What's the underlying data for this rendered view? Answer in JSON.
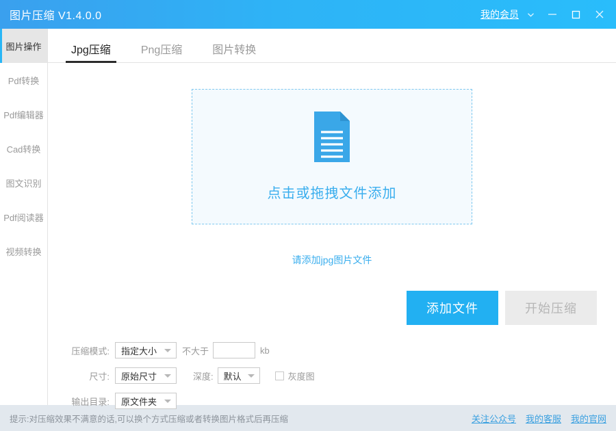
{
  "titlebar": {
    "app_title": "图片压缩 V1.4.0.0",
    "member_link": "我的会员",
    "icons": {
      "chevron": "chevron-down-icon",
      "minimize": "minimize-icon",
      "maximize": "maximize-icon",
      "close": "close-icon"
    },
    "gradient_from": "#3aa0ee",
    "gradient_to": "#29bdfb"
  },
  "sidebar": {
    "items": [
      {
        "label": "图片操作",
        "active": true
      },
      {
        "label": "Pdf转换",
        "active": false
      },
      {
        "label": "Pdf编辑器",
        "active": false
      },
      {
        "label": "Cad转换",
        "active": false
      },
      {
        "label": "图文识别",
        "active": false
      },
      {
        "label": "Pdf阅读器",
        "active": false
      },
      {
        "label": "视频转换",
        "active": false
      }
    ],
    "active_accent": "#29b6f6"
  },
  "tabs": [
    {
      "label": "Jpg压缩",
      "active": true
    },
    {
      "label": "Png压缩",
      "active": false
    },
    {
      "label": "图片转换",
      "active": false
    }
  ],
  "dropzone": {
    "icon": "document-file-icon",
    "label": "点击或拖拽文件添加",
    "accent": "#3aaeee",
    "background": "#f4fafe",
    "border": "#7ec8ef"
  },
  "hint": "请添加jpg图片文件",
  "buttons": {
    "add_file": "添加文件",
    "start_compress": "开始压缩",
    "primary_color": "#22b0f2",
    "disabled_color": "#ebebeb"
  },
  "settings": {
    "mode": {
      "label": "压缩模式:",
      "value": "指定大小",
      "condition_text": "不大于",
      "size_value": "",
      "size_placeholder": "",
      "unit": "kb"
    },
    "size": {
      "label": "尺寸:",
      "value": "原始尺寸"
    },
    "depth": {
      "label": "深度:",
      "value": "默认"
    },
    "grayscale": {
      "label": "灰度图",
      "checked": false
    },
    "output": {
      "label": "输出目录:",
      "value": "原文件夹"
    }
  },
  "footer": {
    "tip": "提示:对压缩效果不满意的话,可以换个方式压缩或者转换图片格式后再压缩",
    "links": [
      {
        "label": "关注公众号"
      },
      {
        "label": "我的客服"
      },
      {
        "label": "我的官网"
      }
    ]
  }
}
